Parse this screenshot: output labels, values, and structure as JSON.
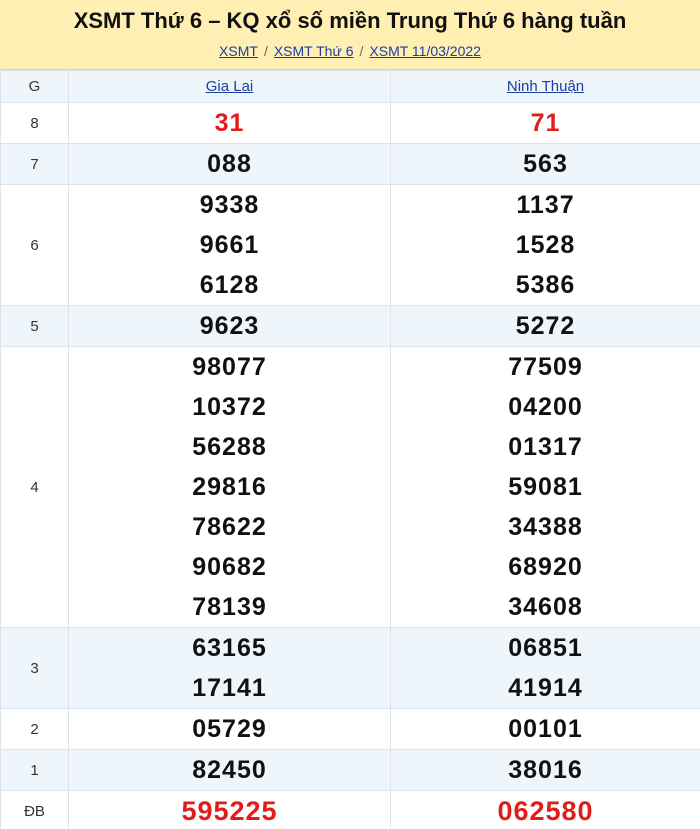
{
  "header": {
    "title": "XSMT Thứ 6 – KQ xổ số miền Trung Thứ 6 hàng tuần",
    "breadcrumb": [
      "XSMT",
      "XSMT Thứ 6",
      "XSMT 11/03/2022"
    ],
    "separator": "/"
  },
  "table": {
    "prize_header": "G",
    "provinces": [
      "Gia Lai",
      "Ninh Thuận"
    ],
    "rows": [
      {
        "label": "8",
        "values": [
          [
            "31"
          ],
          [
            "71"
          ]
        ]
      },
      {
        "label": "7",
        "values": [
          [
            "088"
          ],
          [
            "563"
          ]
        ]
      },
      {
        "label": "6",
        "values": [
          [
            "9338",
            "9661",
            "6128"
          ],
          [
            "1137",
            "1528",
            "5386"
          ]
        ]
      },
      {
        "label": "5",
        "values": [
          [
            "9623"
          ],
          [
            "5272"
          ]
        ]
      },
      {
        "label": "4",
        "values": [
          [
            "98077",
            "10372",
            "56288",
            "29816",
            "78622",
            "90682",
            "78139"
          ],
          [
            "77509",
            "04200",
            "01317",
            "59081",
            "34388",
            "68920",
            "34608"
          ]
        ]
      },
      {
        "label": "3",
        "values": [
          [
            "63165",
            "17141"
          ],
          [
            "06851",
            "41914"
          ]
        ]
      },
      {
        "label": "2",
        "values": [
          [
            "05729"
          ],
          [
            "00101"
          ]
        ]
      },
      {
        "label": "1",
        "values": [
          [
            "82450"
          ],
          [
            "38016"
          ]
        ]
      },
      {
        "label": "ĐB",
        "values": [
          [
            "595225"
          ],
          [
            "062580"
          ]
        ]
      }
    ]
  },
  "colors": {
    "header_bg": "#ffefb3",
    "stripe_bg": "#eef5fb",
    "highlight_red": "#e21b1b",
    "link_blue": "#1a3fa3"
  }
}
